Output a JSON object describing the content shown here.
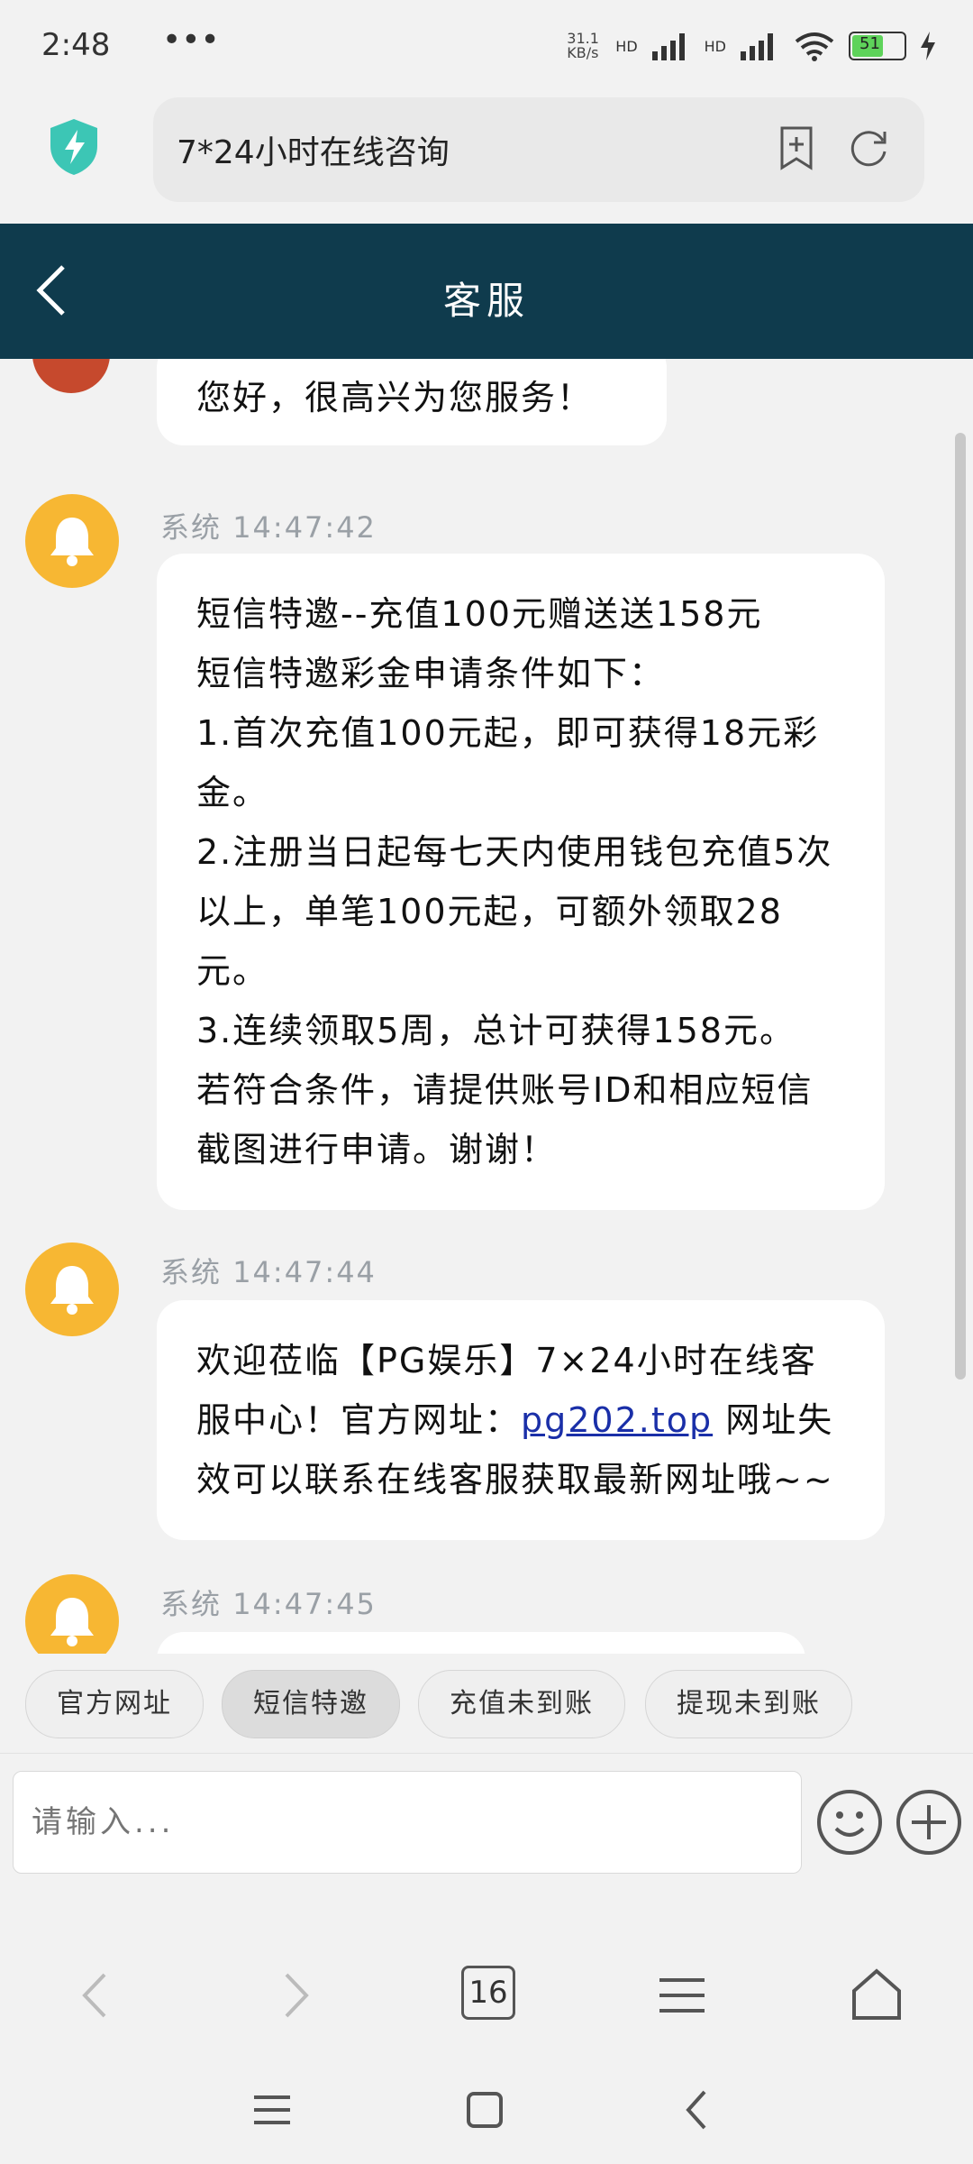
{
  "status": {
    "time": "2:48",
    "dots": "•••",
    "speed": "31.1 KB/s",
    "network": "HD",
    "battery": "51"
  },
  "browser": {
    "url_text": "7*24小时在线咨询",
    "tab_count": "16"
  },
  "chat": {
    "title": "客服",
    "first_message_text": "您好，很高兴为您服务！",
    "messages": [
      {
        "sender": "系统",
        "time": "14:47:42",
        "lines": [
          "短信特邀--充值100元赠送送158元",
          "短信特邀彩金申请条件如下：",
          "1.首次充值100元起，即可获得18元彩金。",
          "2.注册当日起每七天内使用钱包充值5次以上，单笔100元起，可额外领取28元。",
          "3.连续领取5周，总计可获得158元。",
          "若符合条件，请提供账号ID和相应短信截图进行申请。谢谢！"
        ]
      },
      {
        "sender": "系统",
        "time": "14:47:44",
        "text_before": "欢迎莅临【PG娱乐】7×24小时在线客服中心！官方网址：",
        "link": "pg202.top",
        "text_after": " 网址失效可以联系在线客服获取最新网址哦~~"
      },
      {
        "sender": "系统",
        "time": "14:47:45"
      }
    ]
  },
  "quick_replies": [
    "官方网址",
    "短信特邀",
    "充值未到账",
    "提现未到账"
  ],
  "input": {
    "placeholder": "请输入..."
  },
  "icons": {
    "shield": "shield-icon",
    "bookmark": "bookmark-add-icon",
    "refresh": "refresh-icon",
    "back": "chevron-left-icon",
    "bell": "bell-icon",
    "emoji": "emoji-icon",
    "plus": "plus-circle-icon"
  },
  "colors": {
    "header": "#0f3b4d",
    "avatar": "#f7b733",
    "link": "#1a2fa8"
  }
}
